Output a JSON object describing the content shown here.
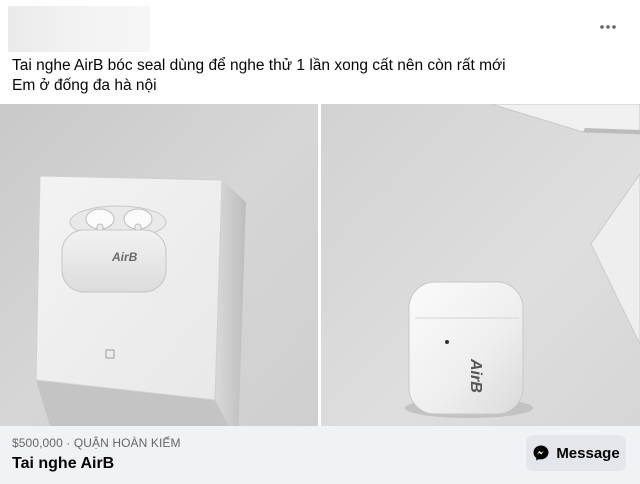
{
  "post": {
    "text_lines": [
      "Tai nghe AirB bóc seal dùng để nghe thử 1 lần xong cất nên còn rất mới",
      "Em ở đống đa hà nội"
    ]
  },
  "photos": [
    {
      "alt": "AirB earbuds box",
      "brand_mark": "AirB"
    },
    {
      "alt": "AirB charging case",
      "brand_mark": "AirB"
    }
  ],
  "marketplace": {
    "price": "$500,000",
    "separator": " · ",
    "location": "QUẬN HOÀN KIẾM",
    "title": "Tai nghe AirB",
    "message_label": "Message"
  },
  "icons": {
    "more": "more-horizontal-icon",
    "messenger": "messenger-icon"
  }
}
